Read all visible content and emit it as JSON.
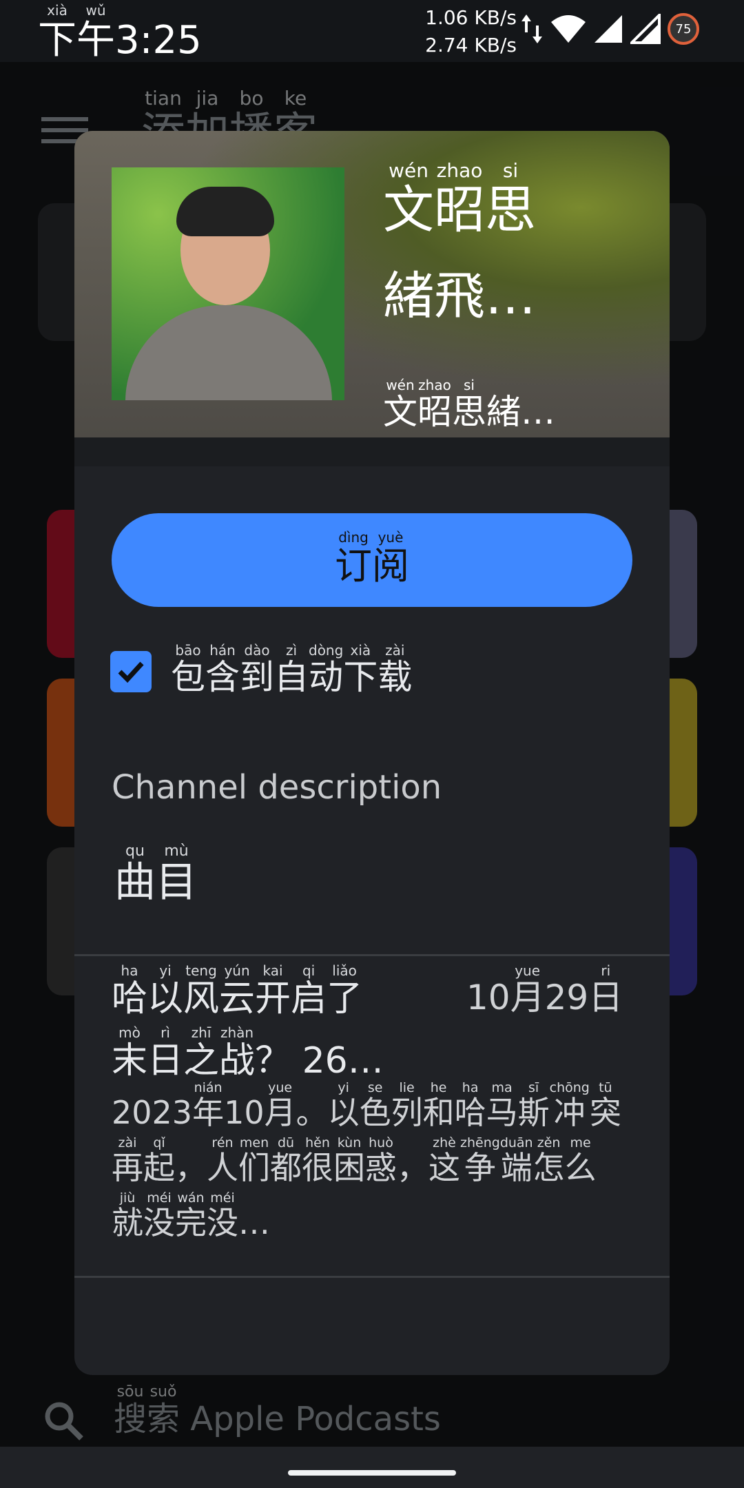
{
  "status_bar": {
    "time": {
      "base": "下午",
      "ruby": [
        "xià",
        "wǔ"
      ],
      "chars": [
        "下",
        "午"
      ],
      "clock": "3:25"
    },
    "speed_up": "1.06 KB/s",
    "speed_down": "2.74 KB/s",
    "battery": "75",
    "icons": [
      "data-arrows-icon",
      "wifi-icon",
      "signal-icon",
      "signal-icon-2",
      "battery-icon"
    ]
  },
  "background": {
    "title": {
      "chars": [
        "添",
        "加",
        "播",
        "客"
      ],
      "ruby": [
        "tian",
        "jia",
        "bo",
        "ke"
      ]
    },
    "search": {
      "chars": [
        "搜",
        "索"
      ],
      "ruby": [
        "sōu",
        "suǒ"
      ],
      "rest": "Apple Podcasts"
    }
  },
  "dialog": {
    "title": {
      "chars": [
        "文",
        "昭",
        "思"
      ],
      "ruby": [
        "wén",
        "zhao",
        "si"
      ],
      "line2": "緒飛…"
    },
    "author": {
      "chars": [
        "文",
        "昭",
        "思"
      ],
      "ruby": [
        "wén",
        "zhao",
        "si"
      ],
      "rest": "緒…"
    },
    "subscribe": {
      "chars": [
        "订",
        "阅"
      ],
      "ruby": [
        "dìng",
        "yuè"
      ]
    },
    "auto_download": {
      "checked": true,
      "chars": [
        "包",
        "含",
        "到",
        "自",
        "动",
        "下",
        "载"
      ],
      "ruby": [
        "bāo",
        "hán",
        "dào",
        "zì",
        "dòng",
        "xià",
        "zài"
      ]
    },
    "description_heading": "Channel description",
    "description": {
      "chars": [
        "曲",
        "目"
      ],
      "ruby": [
        "qu",
        "mù"
      ]
    },
    "episode": {
      "title_line1": {
        "chars": [
          "哈",
          "以",
          "风",
          "云",
          "开",
          "启",
          "了"
        ],
        "ruby": [
          "ha",
          "yi",
          "teng",
          "yún",
          "kai",
          "qi",
          "liǎo"
        ]
      },
      "title_line2": {
        "chars": [
          "末",
          "日",
          "之",
          "战"
        ],
        "ruby": [
          "mò",
          "rì",
          "zhī",
          "zhàn"
        ],
        "rest": "？ 26…"
      },
      "date": {
        "prefix": "10",
        "chars": [
          "月"
        ],
        "ruby": [
          "yue"
        ],
        "mid": "29",
        "chars2": [
          "日"
        ],
        "ruby2": [
          "ri"
        ]
      },
      "desc_segments": [
        {
          "t": "2023"
        },
        {
          "c": "年",
          "r": "nián"
        },
        {
          "t": "10"
        },
        {
          "c": "月",
          "r": "yue"
        },
        {
          "t": "。"
        },
        {
          "c": "以",
          "r": "yi"
        },
        {
          "c": "色",
          "r": "se"
        },
        {
          "c": "列",
          "r": "lie"
        },
        {
          "c": "和",
          "r": "he"
        },
        {
          "c": "哈",
          "r": "ha"
        },
        {
          "c": "马",
          "r": "ma"
        },
        {
          "c": "斯",
          "r": "sī"
        },
        {
          "c": "冲",
          "r": "chōng"
        },
        {
          "c": "突",
          "r": "tū"
        },
        {
          "c": "再",
          "r": "zài"
        },
        {
          "c": "起",
          "r": "qǐ"
        },
        {
          "t": "，"
        },
        {
          "c": "人",
          "r": "rén"
        },
        {
          "c": "们",
          "r": "men"
        },
        {
          "c": "都",
          "r": "dū"
        },
        {
          "c": "很",
          "r": "hěn"
        },
        {
          "c": "困",
          "r": "kùn"
        },
        {
          "c": "惑",
          "r": "huò"
        },
        {
          "t": "，"
        },
        {
          "c": "这",
          "r": "zhè"
        },
        {
          "c": "争",
          "r": "zhēng"
        },
        {
          "c": "端",
          "r": "duān"
        },
        {
          "c": "怎",
          "r": "zěn"
        },
        {
          "c": "么",
          "r": "me"
        },
        {
          "c": "就",
          "r": "jiù"
        },
        {
          "c": "没",
          "r": "méi"
        },
        {
          "c": "完",
          "r": "wán"
        },
        {
          "c": "没",
          "r": "méi"
        },
        {
          "t": "…"
        }
      ]
    }
  },
  "colors": {
    "accent": "#3f88ff",
    "dialog_bg": "#202226",
    "page_bg": "#141619"
  }
}
